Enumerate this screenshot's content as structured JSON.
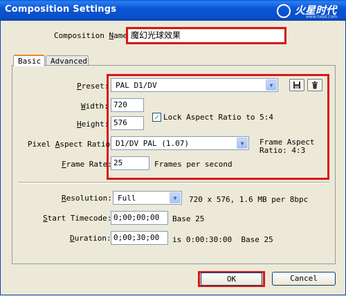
{
  "window": {
    "title": "Composition Settings"
  },
  "brand": {
    "name": "火星时代",
    "url": "www.hxsd.com"
  },
  "composition_name": {
    "label_pre": "Composition ",
    "label_u": "N",
    "label_post": "ame:",
    "value": "魔幻光球效果"
  },
  "tabs": [
    {
      "label": "Basic",
      "active": true
    },
    {
      "label": "Advanced",
      "active": false
    }
  ],
  "basic": {
    "preset": {
      "label_u": "P",
      "label_post": "reset:",
      "value": "PAL D1/DV"
    },
    "width": {
      "label_u": "W",
      "label_post": "idth:",
      "value": "720"
    },
    "height": {
      "label_u": "H",
      "label_post": "eight:",
      "value": "576"
    },
    "lock_aspect": {
      "label": "Lock Aspect Ratio to 5:4",
      "checked": true
    },
    "pixel_aspect": {
      "label_pre": "Pixel ",
      "label_u": "A",
      "label_post": "spect Ratio:",
      "value": "D1/DV PAL (1.07)"
    },
    "frame_aspect": {
      "line1": "Frame Aspect",
      "line2": "Ratio: 4:3"
    },
    "frame_rate": {
      "label_u": "F",
      "label_post": "rame Rate:",
      "value": "25",
      "suffix": "Frames per second"
    },
    "resolution": {
      "label_u": "R",
      "label_post": "esolution:",
      "value": "Full",
      "info": "720 x 576, 1.6 MB per 8bpc"
    },
    "start_timecode": {
      "label_u": "S",
      "label_post": "tart Timecode:",
      "value": "0;00;00;00",
      "info": "Base 25"
    },
    "duration": {
      "label_u": "D",
      "label_post": "uration:",
      "value": "0;00;30;00",
      "info": "is 0:00:30:00  Base 25"
    }
  },
  "buttons": {
    "ok": "OK",
    "cancel": "Cancel"
  },
  "icons": {
    "save": "save-preset-icon",
    "delete": "delete-preset-icon"
  },
  "colors": {
    "highlight": "#d8151b",
    "titlebar": "#0a4fc7"
  }
}
